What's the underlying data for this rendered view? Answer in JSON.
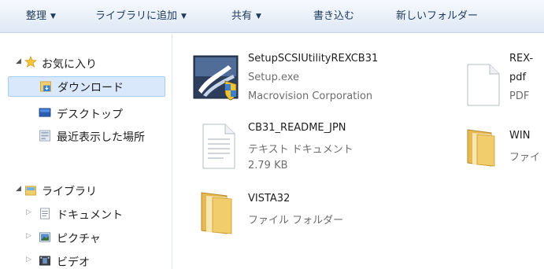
{
  "toolbar": {
    "organize": "整理",
    "library": "ライブラリに追加",
    "share": "共有",
    "burn": "書き込む",
    "new_folder": "新しいフォルダー",
    "arrow": "▼"
  },
  "nav": {
    "favorites": "お気に入り",
    "downloads": "ダウンロード",
    "desktop": "デスクトップ",
    "recent": "最近表示した場所",
    "libraries": "ライブラリ",
    "documents": "ドキュメント",
    "pictures": "ピクチャ",
    "videos": "ビデオ"
  },
  "files": [
    {
      "name": "SetupSCSIUtilityREXCB31",
      "line2": "Setup.exe",
      "line3": "Macrovision Corporation"
    },
    {
      "name": "REX-",
      "line2": "pdf",
      "line3": "PDF"
    },
    {
      "name": "CB31_README_JPN",
      "line2": "テキスト ドキュメント",
      "line3": "2.79 KB"
    },
    {
      "name": "WIN",
      "line2": "ファイ"
    },
    {
      "name": "VISTA32",
      "line2": "ファイル フォルダー"
    }
  ],
  "colors": {
    "toolbar_text": "#1e395b",
    "selection_bg": "#d9e9fb",
    "selection_border": "#aacdf5",
    "folder": "#f2cd6b"
  }
}
